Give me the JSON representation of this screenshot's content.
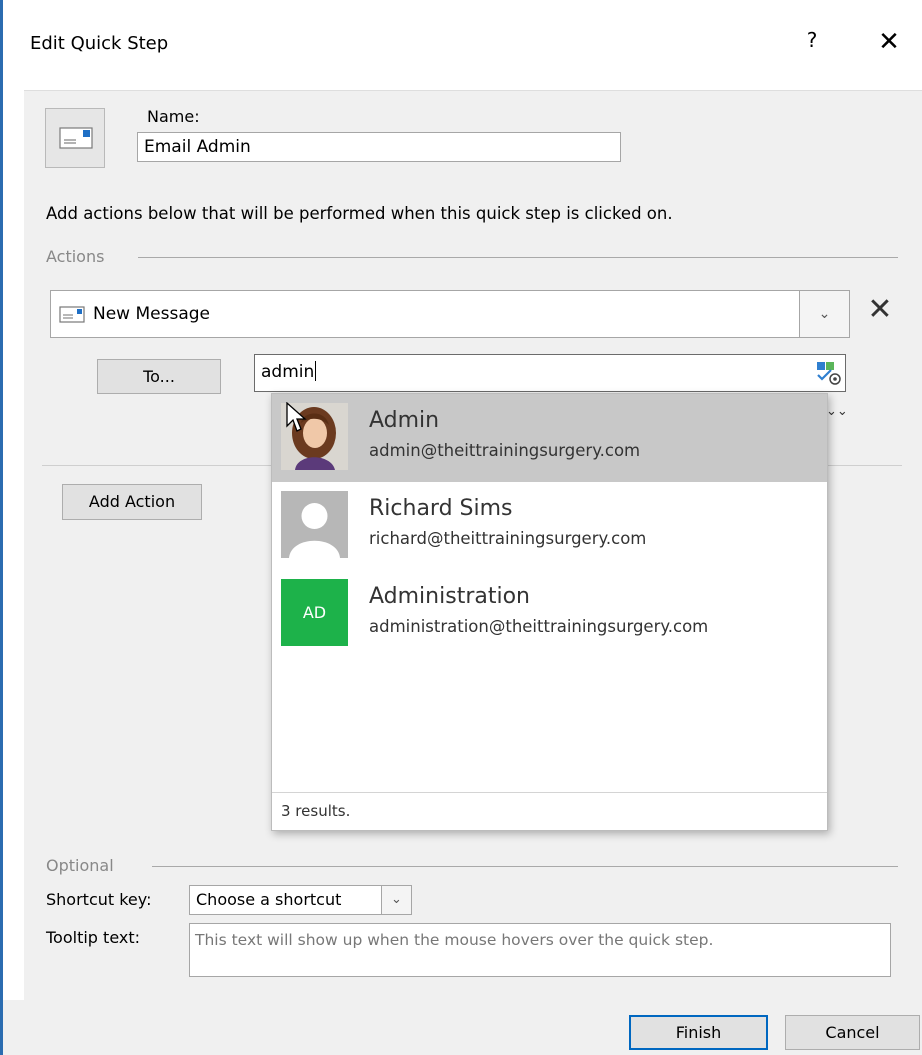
{
  "dialog": {
    "title": "Edit Quick Step",
    "help_label": "?",
    "close_label": "✕"
  },
  "name_section": {
    "label": "Name:",
    "value": "Email Admin"
  },
  "instructions": "Add actions below that will be performed when this quick step is clicked on.",
  "actions": {
    "section_label": "Actions",
    "selected_action": "New Message",
    "delete_label": "✕",
    "to_button_label": "To...",
    "to_field_value": "admin",
    "add_action_label": "Add Action"
  },
  "autocomplete": {
    "items": [
      {
        "name": "Admin",
        "email": "admin@theittrainingsurgery.com",
        "avatar_type": "photo"
      },
      {
        "name": "Richard Sims",
        "email": "richard@theittrainingsurgery.com",
        "avatar_type": "placeholder"
      },
      {
        "name": "Administration",
        "email": "administration@theittrainingsurgery.com",
        "avatar_type": "initials",
        "initials": "AD",
        "avatar_color": "#1db24a"
      }
    ],
    "results_text": "3 results."
  },
  "optional": {
    "section_label": "Optional",
    "shortcut_label": "Shortcut key:",
    "shortcut_value": "Choose a shortcut",
    "tooltip_label": "Tooltip text:",
    "tooltip_value": "This text will show up when the mouse hovers over the quick step."
  },
  "footer": {
    "finish_label": "Finish",
    "cancel_label": "Cancel"
  },
  "colors": {
    "accent": "#0067c0",
    "selected_row": "#c8c8c8",
    "panel_bg": "#f0f0f0"
  }
}
